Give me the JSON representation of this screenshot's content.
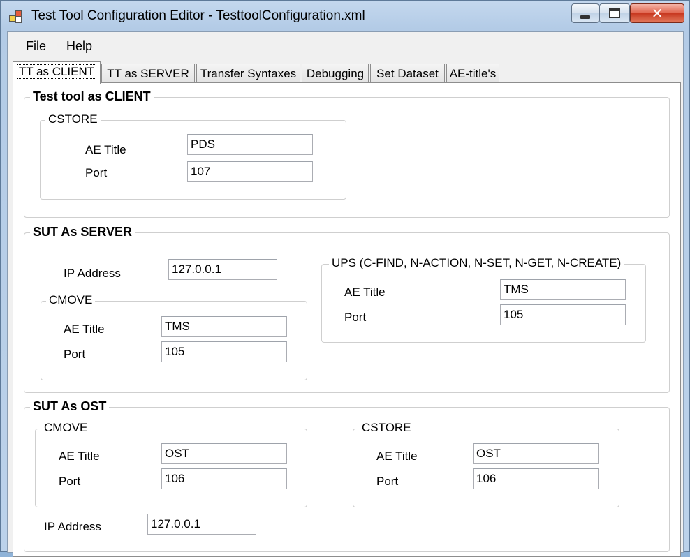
{
  "window": {
    "title": "Test Tool Configuration Editor - TesttoolConfiguration.xml",
    "close_glyph": "✕"
  },
  "menu": {
    "items": [
      "File",
      "Help"
    ]
  },
  "tabs": [
    "TT as CLIENT",
    "TT as SERVER",
    "Transfer Syntaxes",
    "Debugging",
    "Set Dataset",
    "AE-title's"
  ],
  "active_tab": "TT as CLIENT",
  "tt_client": {
    "title": "Test tool as CLIENT",
    "cstore": {
      "title": "CSTORE",
      "ae_label": "AE Title",
      "ae_value": "PDS",
      "port_label": "Port",
      "port_value": "107"
    }
  },
  "sut_server": {
    "title": "SUT As SERVER",
    "ip_label": "IP Address",
    "ip_value": "127.0.0.1",
    "cmove": {
      "title": "CMOVE",
      "ae_label": "AE Title",
      "ae_value": "TMS",
      "port_label": "Port",
      "port_value": "105"
    },
    "ups": {
      "title": "UPS (C-FIND, N-ACTION, N-SET, N-GET, N-CREATE)",
      "ae_label": "AE Title",
      "ae_value": "TMS",
      "port_label": "Port",
      "port_value": "105"
    }
  },
  "sut_ost": {
    "title": "SUT As OST",
    "cmove": {
      "title": "CMOVE",
      "ae_label": "AE Title",
      "ae_value": "OST",
      "port_label": "Port",
      "port_value": "106"
    },
    "cstore": {
      "title": "CSTORE",
      "ae_label": "AE Title",
      "ae_value": "OST",
      "port_label": "Port",
      "port_value": "106"
    },
    "ip_label": "IP Address",
    "ip_value": "127.0.0.1"
  }
}
